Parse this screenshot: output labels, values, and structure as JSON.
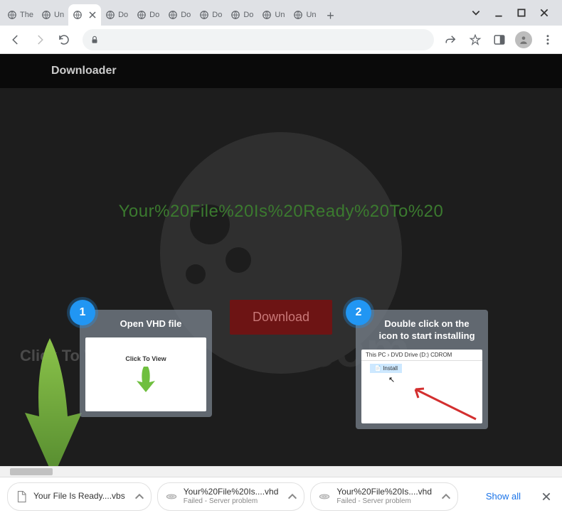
{
  "tabs": [
    {
      "title": "The",
      "active": false
    },
    {
      "title": "Un",
      "active": false
    },
    {
      "title": "",
      "active": true
    },
    {
      "title": "Do",
      "active": false
    },
    {
      "title": "Do",
      "active": false
    },
    {
      "title": "Do",
      "active": false
    },
    {
      "title": "Do",
      "active": false
    },
    {
      "title": "Do",
      "active": false
    },
    {
      "title": "Un",
      "active": false
    },
    {
      "title": "Un",
      "active": false
    }
  ],
  "page": {
    "header": "Downloader",
    "file_title": "Your%20File%20Is%20Ready%20To%20",
    "download_label": "Download",
    "click_to_view": "Click To View"
  },
  "steps": [
    {
      "num": "1",
      "title": "Open VHD file",
      "img_label": "Click To View"
    },
    {
      "num": "2",
      "title": "Double click on the icon to start installing",
      "breadcrumb": "This PC  ›  DVD Drive (D:) CDROM",
      "install": "Install"
    }
  ],
  "downloads": {
    "items": [
      {
        "name": "Your File Is Ready....vbs",
        "status": ""
      },
      {
        "name": "Your%20File%20Is....vhd",
        "status": "Failed - Server problem"
      },
      {
        "name": "Your%20File%20Is....vhd",
        "status": "Failed - Server problem"
      }
    ],
    "show_all": "Show all"
  }
}
